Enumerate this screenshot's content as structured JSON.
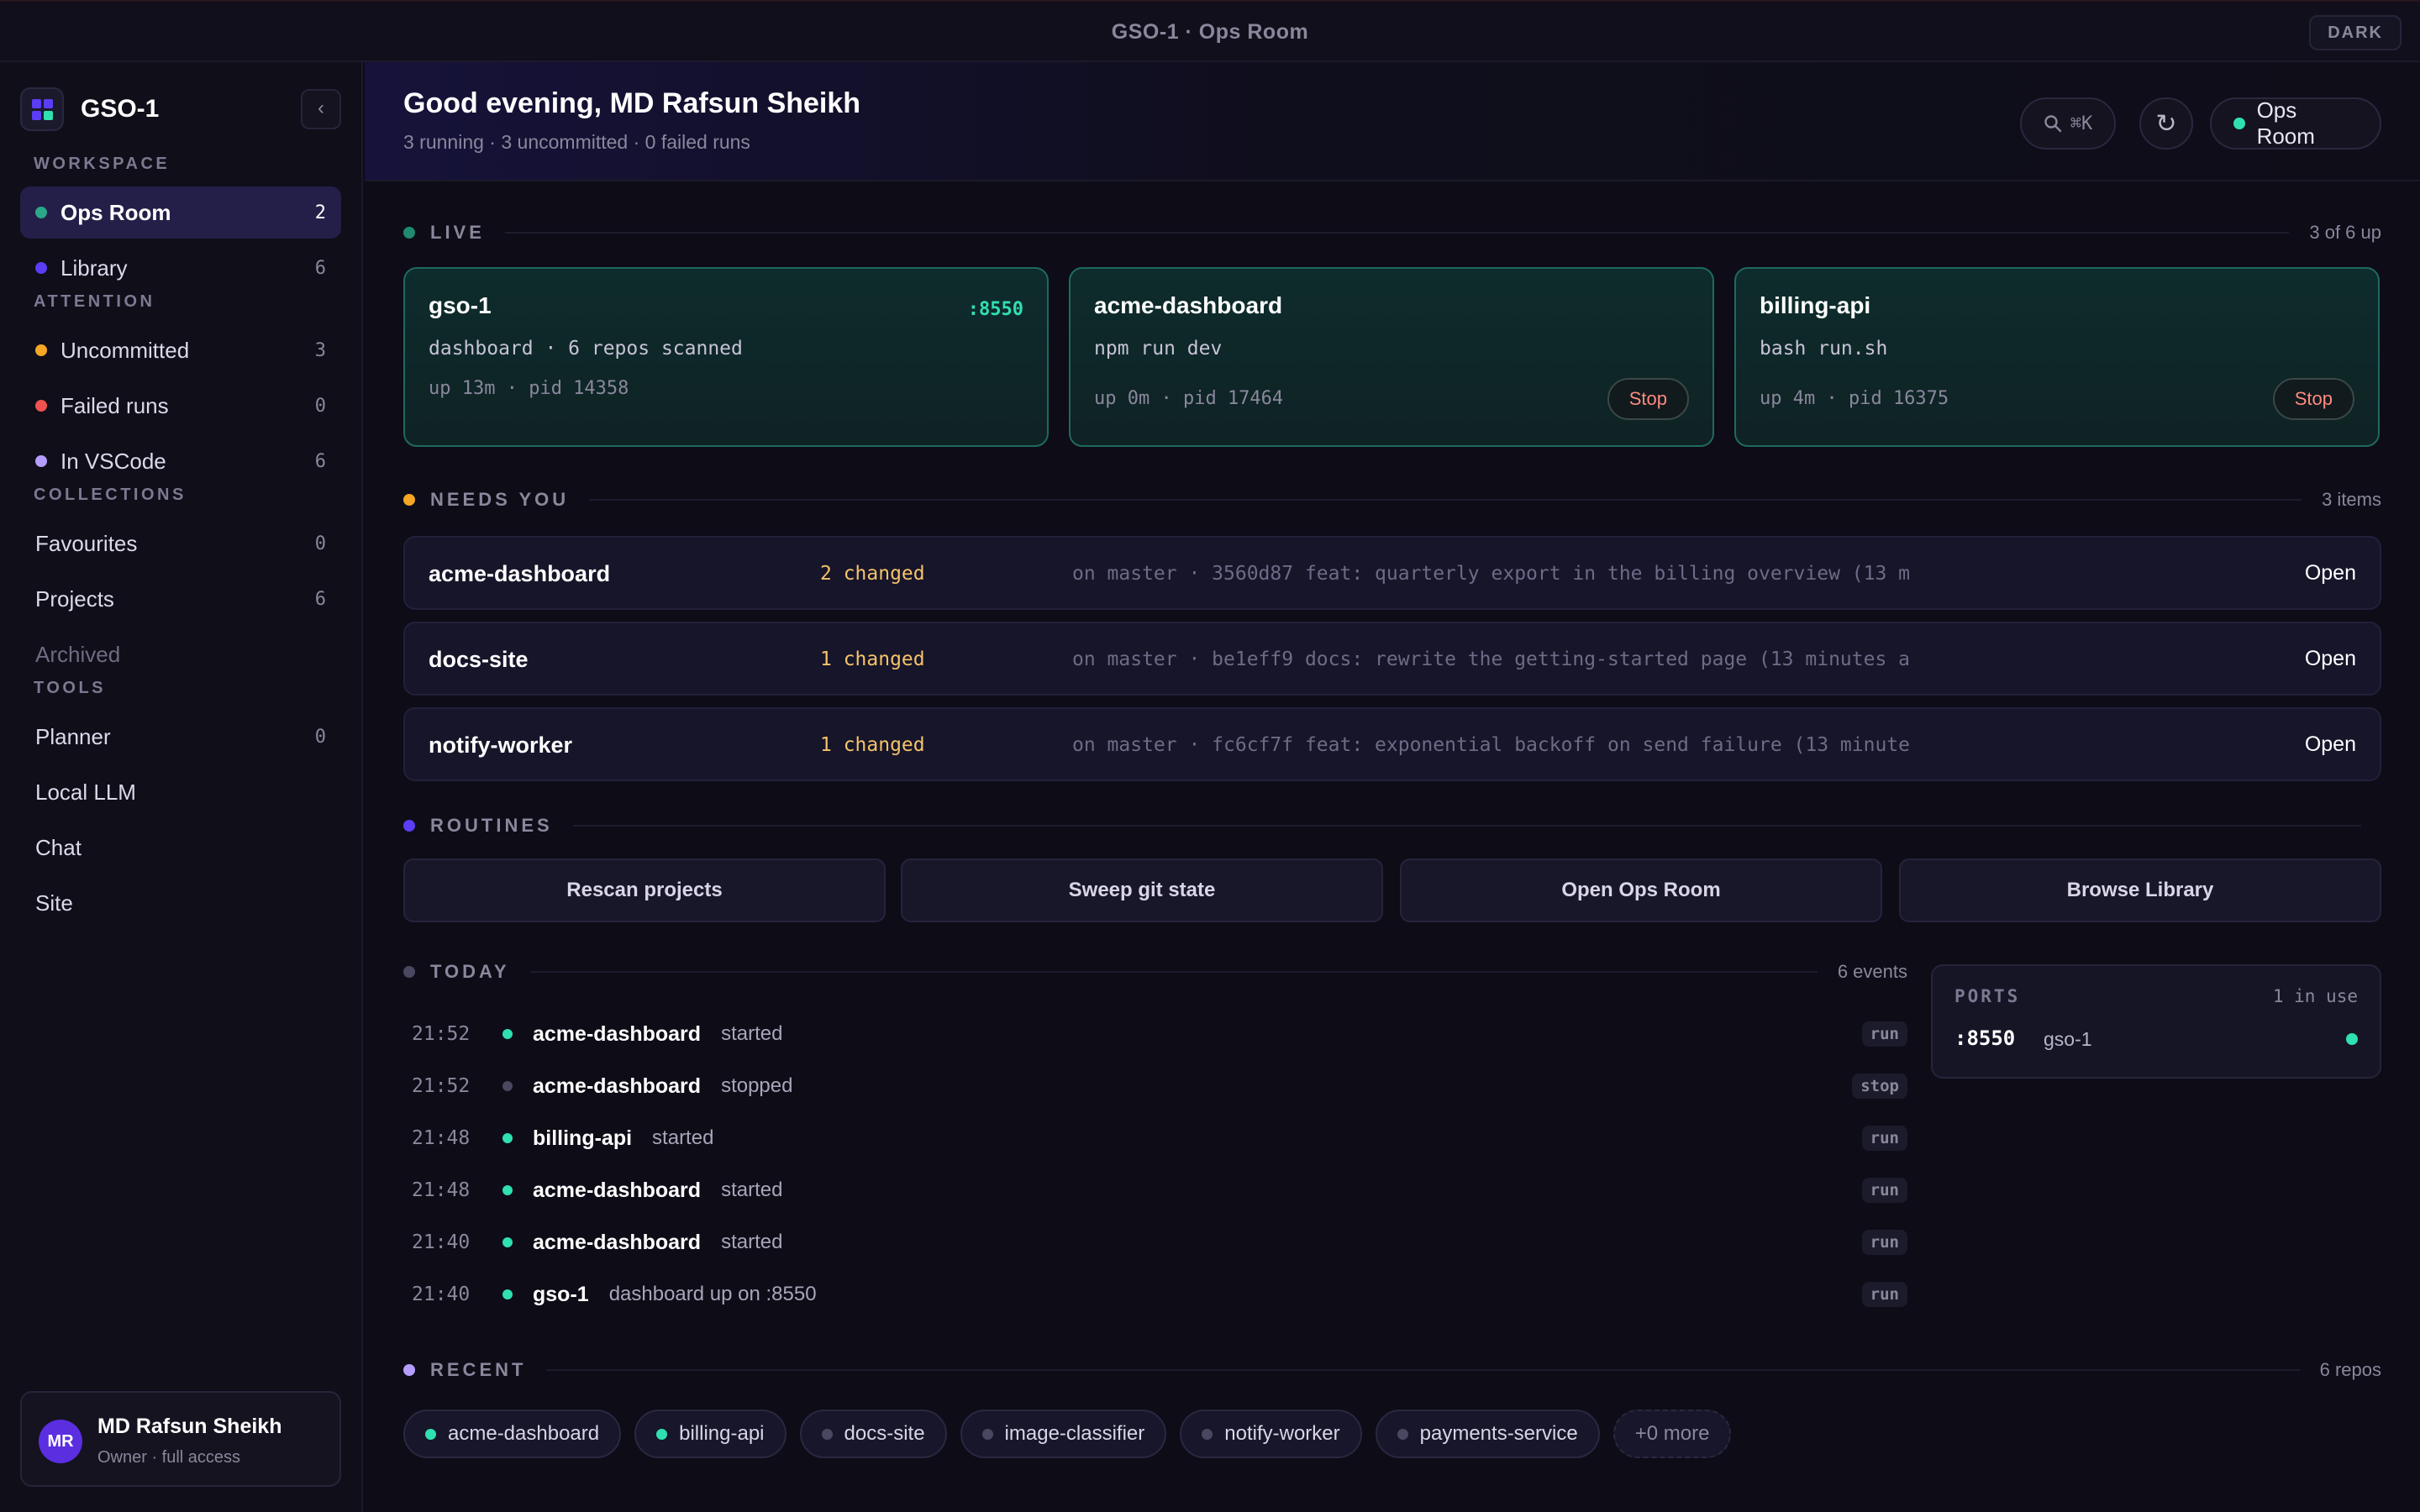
{
  "window": {
    "title": "GSO-1 · Ops Room",
    "theme_label": "DARK"
  },
  "colors": {
    "accent": "#5b2ee0",
    "green": "#2fe0b0",
    "amber": "#f5a623",
    "red": "#f0524f",
    "violet": "#5b3df5",
    "lavender": "#b59cff",
    "grey": "#4a4860"
  },
  "sidebar": {
    "brand": "GSO-1",
    "collapse_icon": "‹",
    "workspace_label": "WORKSPACE",
    "workspace": [
      {
        "label": "Ops Room",
        "count": "2",
        "dot": "#2aa889"
      },
      {
        "label": "Library",
        "count": "6",
        "dot": "#5b3df5"
      }
    ],
    "attention_label": "ATTENTION",
    "attention": [
      {
        "label": "Uncommitted",
        "count": "3",
        "dot": "#f5a623"
      },
      {
        "label": "Failed runs",
        "count": "0",
        "dot": "#f0524f"
      },
      {
        "label": "In VSCode",
        "count": "6",
        "dot": "#b59cff"
      }
    ],
    "collections_label": "COLLECTIONS",
    "collections": [
      {
        "label": "Favourites",
        "count": "0"
      },
      {
        "label": "Projects",
        "count": "6"
      },
      {
        "label": "Archived",
        "count": ""
      }
    ],
    "tools_label": "TOOLS",
    "tools": [
      {
        "label": "Planner",
        "count": "0"
      },
      {
        "label": "Local LLM",
        "count": ""
      },
      {
        "label": "Chat",
        "count": ""
      },
      {
        "label": "Site",
        "count": ""
      }
    ],
    "user": {
      "initials": "MR",
      "name": "MD Rafsun Sheikh",
      "role": "Owner · full access"
    }
  },
  "header": {
    "greeting": "Good evening, MD Rafsun Sheikh",
    "summary": "3 running · 3 uncommitted · 0 failed runs",
    "search_shortcut": "⌘K",
    "refresh_icon": "↻",
    "room_label": "Ops Room"
  },
  "live": {
    "title": "LIVE",
    "meta": "3 of 6 up",
    "cards": [
      {
        "name": "gso-1",
        "port": ":8550",
        "cmd": "dashboard · 6 repos scanned",
        "info": "up 13m · pid 14358",
        "stop": ""
      },
      {
        "name": "acme-dashboard",
        "port": "",
        "cmd": "npm run dev",
        "info": "up 0m · pid 17464",
        "stop": "Stop"
      },
      {
        "name": "billing-api",
        "port": "",
        "cmd": "bash run.sh",
        "info": "up 4m · pid 16375",
        "stop": "Stop"
      }
    ]
  },
  "needs": {
    "title": "NEEDS YOU",
    "meta": "3 items",
    "items": [
      {
        "name": "acme-dashboard",
        "changed": "2 changed",
        "commit": "on master · 3560d87 feat: quarterly export in the billing overview (13 m",
        "open": "Open"
      },
      {
        "name": "docs-site",
        "changed": "1 changed",
        "commit": "on master · be1eff9 docs: rewrite the getting-started page (13 minutes a",
        "open": "Open"
      },
      {
        "name": "notify-worker",
        "changed": "1 changed",
        "commit": "on master · fc6cf7f feat: exponential backoff on send failure (13 minute",
        "open": "Open"
      }
    ]
  },
  "routines": {
    "title": "ROUTINES",
    "buttons": [
      "Rescan projects",
      "Sweep git state",
      "Open Ops Room",
      "Browse Library"
    ]
  },
  "today": {
    "title": "TODAY",
    "meta": "6 events",
    "events": [
      {
        "time": "21:52",
        "repo": "acme-dashboard",
        "what": "started",
        "tag": "run",
        "dot": "#2fe0b0"
      },
      {
        "time": "21:52",
        "repo": "acme-dashboard",
        "what": "stopped",
        "tag": "stop",
        "dot": "#4a4860"
      },
      {
        "time": "21:48",
        "repo": "billing-api",
        "what": "started",
        "tag": "run",
        "dot": "#2fe0b0"
      },
      {
        "time": "21:48",
        "repo": "acme-dashboard",
        "what": "started",
        "tag": "run",
        "dot": "#2fe0b0"
      },
      {
        "time": "21:40",
        "repo": "acme-dashboard",
        "what": "started",
        "tag": "run",
        "dot": "#2fe0b0"
      },
      {
        "time": "21:40",
        "repo": "gso-1",
        "what": "dashboard up on :8550",
        "tag": "run",
        "dot": "#2fe0b0"
      }
    ]
  },
  "ports": {
    "title": "PORTS",
    "meta": "1 in use",
    "port": ":8550",
    "name": "gso-1"
  },
  "recent": {
    "title": "RECENT",
    "meta": "6 repos",
    "chips": [
      {
        "label": "acme-dashboard",
        "dot": "#2fe0b0"
      },
      {
        "label": "billing-api",
        "dot": "#2fe0b0"
      },
      {
        "label": "docs-site",
        "dot": "#4a4860"
      },
      {
        "label": "image-classifier",
        "dot": "#4a4860"
      },
      {
        "label": "notify-worker",
        "dot": "#4a4860"
      },
      {
        "label": "payments-service",
        "dot": "#4a4860"
      }
    ],
    "more": "+0 more"
  }
}
